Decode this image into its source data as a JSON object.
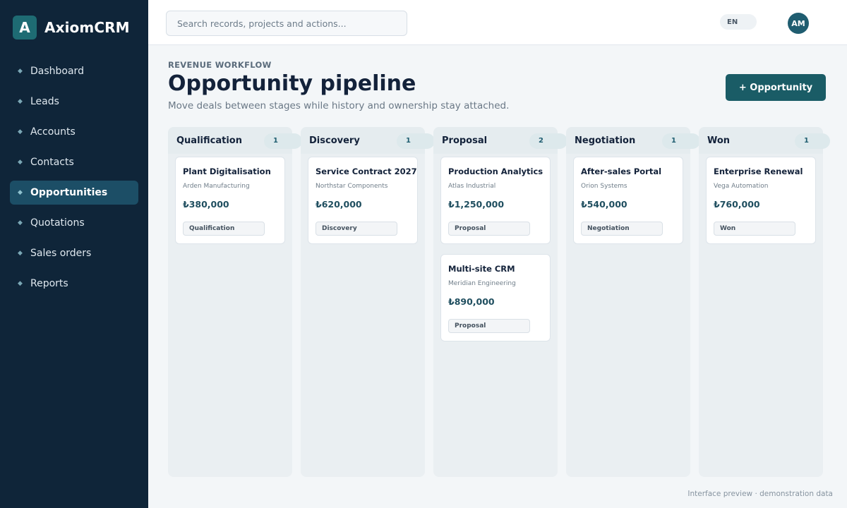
{
  "brand": {
    "mark": "A",
    "name": "AxiomCRM"
  },
  "sidebar": {
    "items": [
      {
        "label": "Dashboard",
        "name": "dashboard"
      },
      {
        "label": "Leads",
        "name": "leads"
      },
      {
        "label": "Accounts",
        "name": "accounts"
      },
      {
        "label": "Contacts",
        "name": "contacts"
      },
      {
        "label": "Opportunities",
        "name": "opportunities",
        "active": true
      },
      {
        "label": "Quotations",
        "name": "quotations"
      },
      {
        "label": "Sales orders",
        "name": "sales-orders"
      },
      {
        "label": "Reports",
        "name": "reports"
      }
    ]
  },
  "topbar": {
    "search_placeholder": "Search records, projects and actions...",
    "language": "EN",
    "avatar_initials": "AM"
  },
  "header": {
    "eyebrow": "REVENUE WORKFLOW",
    "title": "Opportunity pipeline",
    "subtitle": "Move deals between stages while history and ownership stay attached.",
    "primary_button": "+ Opportunity"
  },
  "columns": [
    {
      "title": "Qualification",
      "count": "1",
      "cards": [
        {
          "title": "Plant Digitalisation",
          "company": "Arden Manufacturing",
          "value": "₺380,000",
          "stage": "Qualification"
        }
      ]
    },
    {
      "title": "Discovery",
      "count": "1",
      "cards": [
        {
          "title": "Service Contract 2027",
          "company": "Northstar Components",
          "value": "₺620,000",
          "stage": "Discovery"
        }
      ]
    },
    {
      "title": "Proposal",
      "count": "2",
      "cards": [
        {
          "title": "Production Analytics",
          "company": "Atlas Industrial",
          "value": "₺1,250,000",
          "stage": "Proposal"
        },
        {
          "title": "Multi-site CRM",
          "company": "Meridian Engineering",
          "value": "₺890,000",
          "stage": "Proposal"
        }
      ]
    },
    {
      "title": "Negotiation",
      "count": "1",
      "cards": [
        {
          "title": "After-sales Portal",
          "company": "Orion Systems",
          "value": "₺540,000",
          "stage": "Negotiation"
        }
      ]
    },
    {
      "title": "Won",
      "count": "1",
      "cards": [
        {
          "title": "Enterprise Renewal",
          "company": "Vega Automation",
          "value": "₺760,000",
          "stage": "Won"
        }
      ]
    }
  ],
  "footer": {
    "note": "Interface preview · demonstration data"
  },
  "colors": {
    "sidebar": "#0f2539",
    "accent": "#1a5c66",
    "active_nav": "#1c4e66"
  }
}
